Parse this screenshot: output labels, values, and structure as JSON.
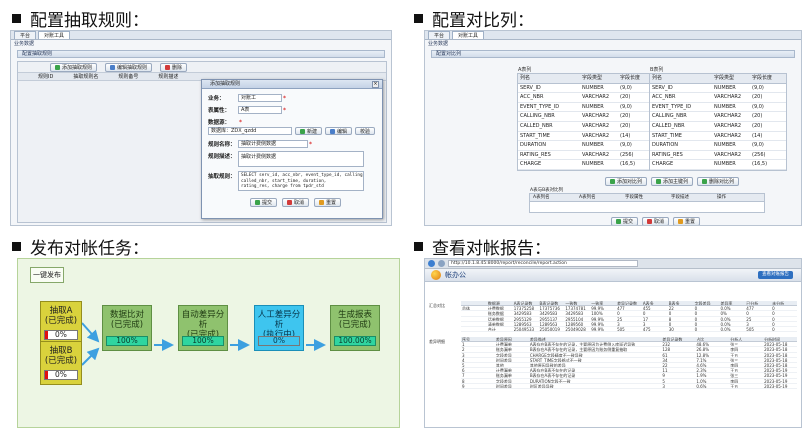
{
  "sections": [
    {
      "title": "配置抽取规则："
    },
    {
      "title": "配置对比列："
    },
    {
      "title": "发布对帐任务："
    },
    {
      "title": "查看对帐报告："
    }
  ],
  "shot1": {
    "tabs": [
      "平台",
      "对账工具"
    ],
    "crumb": "业务数据",
    "panel_title": "配置抽取规则",
    "toolbar": [
      "添加抽取规则",
      "编辑抽取规则",
      "删除"
    ],
    "grid_head": [
      "规则ID",
      "抽取规则名",
      "规则备号",
      "规则描述"
    ],
    "dialog": {
      "title": "添加抽取规则",
      "labels": {
        "business": "业务：",
        "table_attr": "表属性：",
        "db": "数据源：",
        "rule_name": "规则名称：",
        "rule_desc": "规则描述：",
        "rule_sql": "抽取规则："
      },
      "business_value": "对账工",
      "table_attr_value": "A表",
      "db_value": "数据库：ZDX_qzdd",
      "db_buttons": [
        "新建",
        "编辑",
        "校验"
      ],
      "rule_name_value": "抽取计费侧数据",
      "rule_desc_value": "抽取计费侧数据",
      "rule_sql_value": "SELECT serv_id, acc_nbr, event_type_id, calling_nbr,\ncalled_nbr, start_time, duration,\nrating_res, charge from tpdr_std",
      "buttons": [
        "提交",
        "取消",
        "重置"
      ]
    }
  },
  "shot2": {
    "tabs": [
      "平台",
      "对账工具"
    ],
    "crumb": "业务数据",
    "panel_title": "配置对比列",
    "left_caption": "A表列",
    "right_caption": "B表列",
    "columns": [
      "列名",
      "字段类型",
      "字段长度"
    ],
    "rows": [
      [
        "SERV_ID",
        "NUMBER",
        "(9,0)"
      ],
      [
        "ACC_NBR",
        "VARCHAR2",
        "(20)"
      ],
      [
        "EVENT_TYPE_ID",
        "NUMBER",
        "(9,0)"
      ],
      [
        "CALLING_NBR",
        "VARCHAR2",
        "(20)"
      ],
      [
        "CALLED_NBR",
        "VARCHAR2",
        "(20)"
      ],
      [
        "START_TIME",
        "VARCHAR2",
        "(14)"
      ],
      [
        "DURATION",
        "NUMBER",
        "(9,0)"
      ],
      [
        "RATING_RES",
        "VARCHAR2",
        "(256)"
      ],
      [
        "CHARGE",
        "NUMBER",
        "(16,5)"
      ]
    ],
    "mid_buttons": [
      "添加对比列",
      "添加主键列",
      "删除对比列"
    ],
    "bottom_caption": "A表与B表对比列",
    "bottom_columns": [
      "A表列名",
      "A表列名",
      "字段属性",
      "字段描述",
      "操作"
    ],
    "buttons": [
      "提交",
      "取消",
      "重置"
    ]
  },
  "shot3": {
    "toolbar_label": "一键发布",
    "extract_a": {
      "name": "抽取A",
      "state": "(已完成)",
      "progress": "0%"
    },
    "extract_b": {
      "name": "抽取B",
      "state": "(已完成)",
      "progress": "0%"
    },
    "compare": {
      "name": "数据比对",
      "state": "(已完成)",
      "progress": "100%"
    },
    "auto": {
      "name": "自动差异分析",
      "state": "(已完成)",
      "progress": "100%"
    },
    "manual": {
      "name": "人工差异分析",
      "state": "(执行中)",
      "progress": "0%"
    },
    "report": {
      "name": "生成报表",
      "state": "(已完成)",
      "progress": "100.00%"
    },
    "colors": {
      "yellow": "#d9d23c",
      "green": "#8fc26e",
      "cyan": "#3ec5ef",
      "arrow": "#3da0e0"
    }
  },
  "shot4": {
    "url": "http://10.1.8.45:8000/report/reconcile/report.action",
    "app_name": "帐办公",
    "right_button": "查看对账报告",
    "top_head": [
      "",
      "数据源",
      "A表记录数",
      "B表记录数",
      "一致数",
      "一致率",
      "差异记录数",
      "A表多",
      "B表多",
      "字段差异",
      "差异率",
      "已分析",
      "未分析"
    ],
    "top_rows": [
      [
        "总体",
        "计费数据",
        "17375258",
        "17375736",
        "17374781",
        "99.9%",
        "477",
        "455",
        "22",
        "0",
        "0.0%",
        "477",
        "0"
      ],
      [
        "",
        "账务数据",
        "3429583",
        "3429583",
        "3429583",
        "100%",
        "0",
        "0",
        "0",
        "0",
        "0%",
        "0",
        "0"
      ],
      [
        "",
        "话单数据",
        "2955129",
        "2955137",
        "2955104",
        "99.9%",
        "25",
        "17",
        "8",
        "0",
        "0.0%",
        "25",
        "0"
      ],
      [
        "",
        "清单数据",
        "1289563",
        "1289563",
        "1289560",
        "99.9%",
        "3",
        "3",
        "0",
        "0",
        "0.0%",
        "3",
        "0"
      ],
      [
        "",
        "合计",
        "25049533",
        "25050019",
        "25049028",
        "99.9%",
        "505",
        "475",
        "30",
        "0",
        "0.0%",
        "505",
        "0"
      ]
    ],
    "left_labels": [
      "汇总对比",
      "差异明细"
    ],
    "bottom_head": [
      "序号",
      "差异原因",
      "差异描述",
      "差异记录数",
      "占比",
      "分析人",
      "分析时间"
    ],
    "bottom_rows": [
      [
        "1",
        "计费漏单",
        "A表存在B表不存在的记录，主要原因为计费侧入库延迟导致",
        "232",
        "48.6%",
        "张三",
        "2023-05-18"
      ],
      [
        "2",
        "账务漏单",
        "B表存在A表不存在的记录，主要原因为账务侧重复抽取",
        "128",
        "26.8%",
        "李四",
        "2023-05-18"
      ],
      [
        "3",
        "字段差异",
        "CHARGE字段精度不一致导致",
        "61",
        "12.8%",
        "王五",
        "2023-05-18"
      ],
      [
        "4",
        "时间差异",
        "START_TIME字段格式不一致",
        "34",
        "7.1%",
        "张三",
        "2023-05-18"
      ],
      [
        "5",
        "其他",
        "其他原因导致的差异",
        "22",
        "4.6%",
        "李四",
        "2023-05-18"
      ],
      [
        "6",
        "计费漏单",
        "A表存在B表不存在的记录",
        "11",
        "2.3%",
        "王五",
        "2023-05-19"
      ],
      [
        "7",
        "账务漏单",
        "B表存在A表不存在的记录",
        "9",
        "1.9%",
        "张三",
        "2023-05-19"
      ],
      [
        "8",
        "字段差异",
        "DURATION字段不一致",
        "5",
        "1.0%",
        "李四",
        "2023-05-19"
      ],
      [
        "9",
        "时间差异",
        "时区差异导致",
        "3",
        "0.6%",
        "王五",
        "2023-05-19"
      ]
    ]
  }
}
